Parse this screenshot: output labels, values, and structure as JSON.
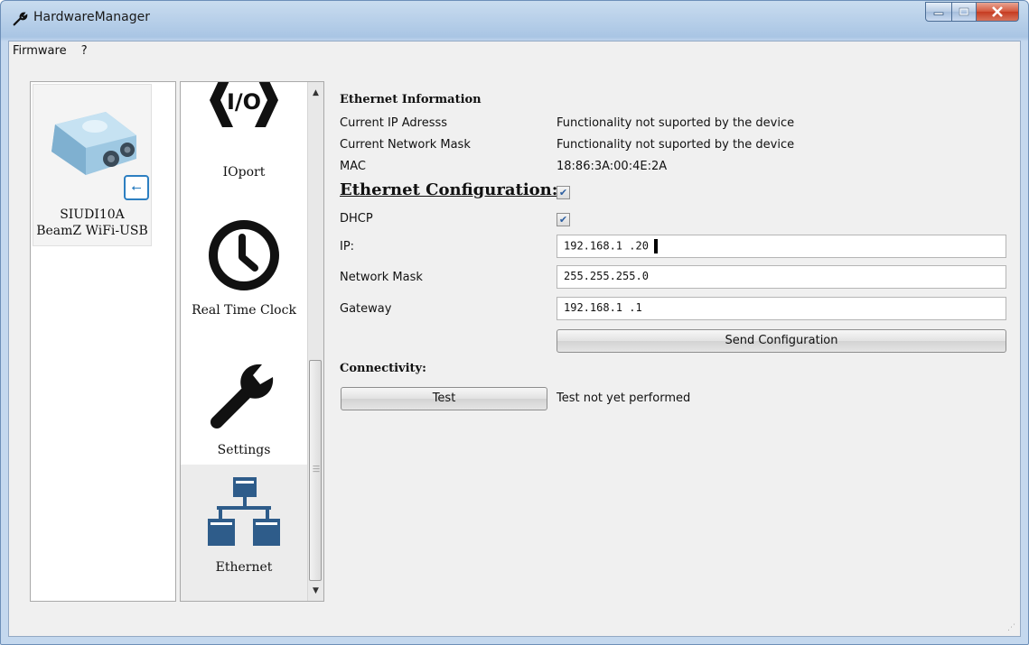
{
  "window": {
    "title": "HardwareManager"
  },
  "menu": {
    "items": [
      "Firmware",
      "?"
    ]
  },
  "device": {
    "model": "SIUDI10A",
    "name": "BeamZ WiFi-USB"
  },
  "pages": [
    {
      "label": "IOport",
      "icon": "io-icon"
    },
    {
      "label": "Real Time Clock",
      "icon": "clock-icon"
    },
    {
      "label": "Settings",
      "icon": "wrench-icon"
    },
    {
      "label": "Ethernet",
      "icon": "network-icon",
      "selected": true
    }
  ],
  "ethernet_info": {
    "heading": "Ethernet Information",
    "rows": [
      {
        "label": "Current IP Adresss",
        "value": "Functionality not suported by the device"
      },
      {
        "label": "Current Network Mask",
        "value": "Functionality not suported by the device"
      },
      {
        "label": "MAC",
        "value": "18:86:3A:00:4E:2A"
      }
    ]
  },
  "ethernet_config": {
    "heading": "Ethernet Configuration:",
    "enabled": true,
    "dhcp_label": "DHCP",
    "dhcp": true,
    "ip_label": "IP:",
    "ip_value": "192.168.1 .20",
    "mask_label": "Network Mask",
    "mask_value": "255.255.255.0",
    "gateway_label": "Gateway",
    "gateway_value": "192.168.1 .1",
    "send_label": "Send Configuration"
  },
  "connectivity": {
    "heading": "Connectivity:",
    "test_label": "Test",
    "status": "Test not yet performed"
  },
  "colors": {
    "accent": "#2d7fc1",
    "network_icon": "#2e5c8a",
    "close_button": "#c53b21"
  }
}
